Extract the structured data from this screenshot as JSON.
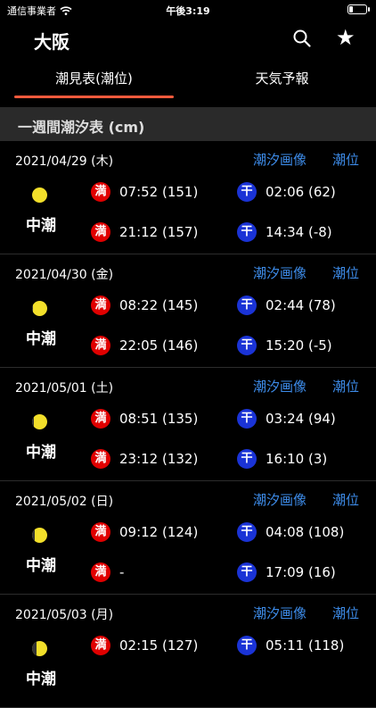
{
  "status": {
    "carrier": "通信事業者",
    "time": "午後3:19",
    "battery_level": 0.3
  },
  "nav": {
    "title": "大阪",
    "search_icon": "search-icon",
    "star_icon": "star-icon"
  },
  "tabs": [
    {
      "label": "潮見表(潮位)",
      "selected": true
    },
    {
      "label": "天気予報",
      "selected": false
    }
  ],
  "colors": {
    "accent": "#ff5a3c",
    "link": "#3d8be8",
    "high": "#e00000",
    "low": "#1a33d6",
    "moon_light": "#f2df2a"
  },
  "section": {
    "title": "一週間潮汐表 (cm)"
  },
  "days": [
    {
      "date": "2021/04/29 (木)",
      "link_image": "潮汐画像",
      "link_level": "潮位",
      "tide": "中潮",
      "moon_dark_fraction": 0.0,
      "high": [
        "07:52 (151)",
        "21:12 (157)"
      ],
      "low": [
        "02:06 (62)",
        "14:34 (-8)"
      ]
    },
    {
      "date": "2021/04/30 (金)",
      "link_image": "潮汐画像",
      "link_level": "潮位",
      "tide": "中潮",
      "moon_dark_fraction": 0.05,
      "high": [
        "08:22 (145)",
        "22:05 (146)"
      ],
      "low": [
        "02:44 (78)",
        "15:20 (-5)"
      ]
    },
    {
      "date": "2021/05/01 (土)",
      "link_image": "潮汐画像",
      "link_level": "潮位",
      "tide": "中潮",
      "moon_dark_fraction": 0.12,
      "high": [
        "08:51 (135)",
        "23:12 (132)"
      ],
      "low": [
        "03:24 (94)",
        "16:10 (3)"
      ]
    },
    {
      "date": "2021/05/02 (日)",
      "link_image": "潮汐画像",
      "link_level": "潮位",
      "tide": "中潮",
      "moon_dark_fraction": 0.2,
      "high": [
        "09:12 (124)",
        "-"
      ],
      "low": [
        "04:08 (108)",
        "17:09 (16)"
      ]
    },
    {
      "date": "2021/05/03 (月)",
      "link_image": "潮汐画像",
      "link_level": "潮位",
      "tide": "中潮",
      "moon_dark_fraction": 0.3,
      "high": [
        "02:15 (127)",
        ""
      ],
      "low": [
        "05:11 (118)",
        ""
      ]
    }
  ],
  "mark_high": "満",
  "mark_low": "干"
}
